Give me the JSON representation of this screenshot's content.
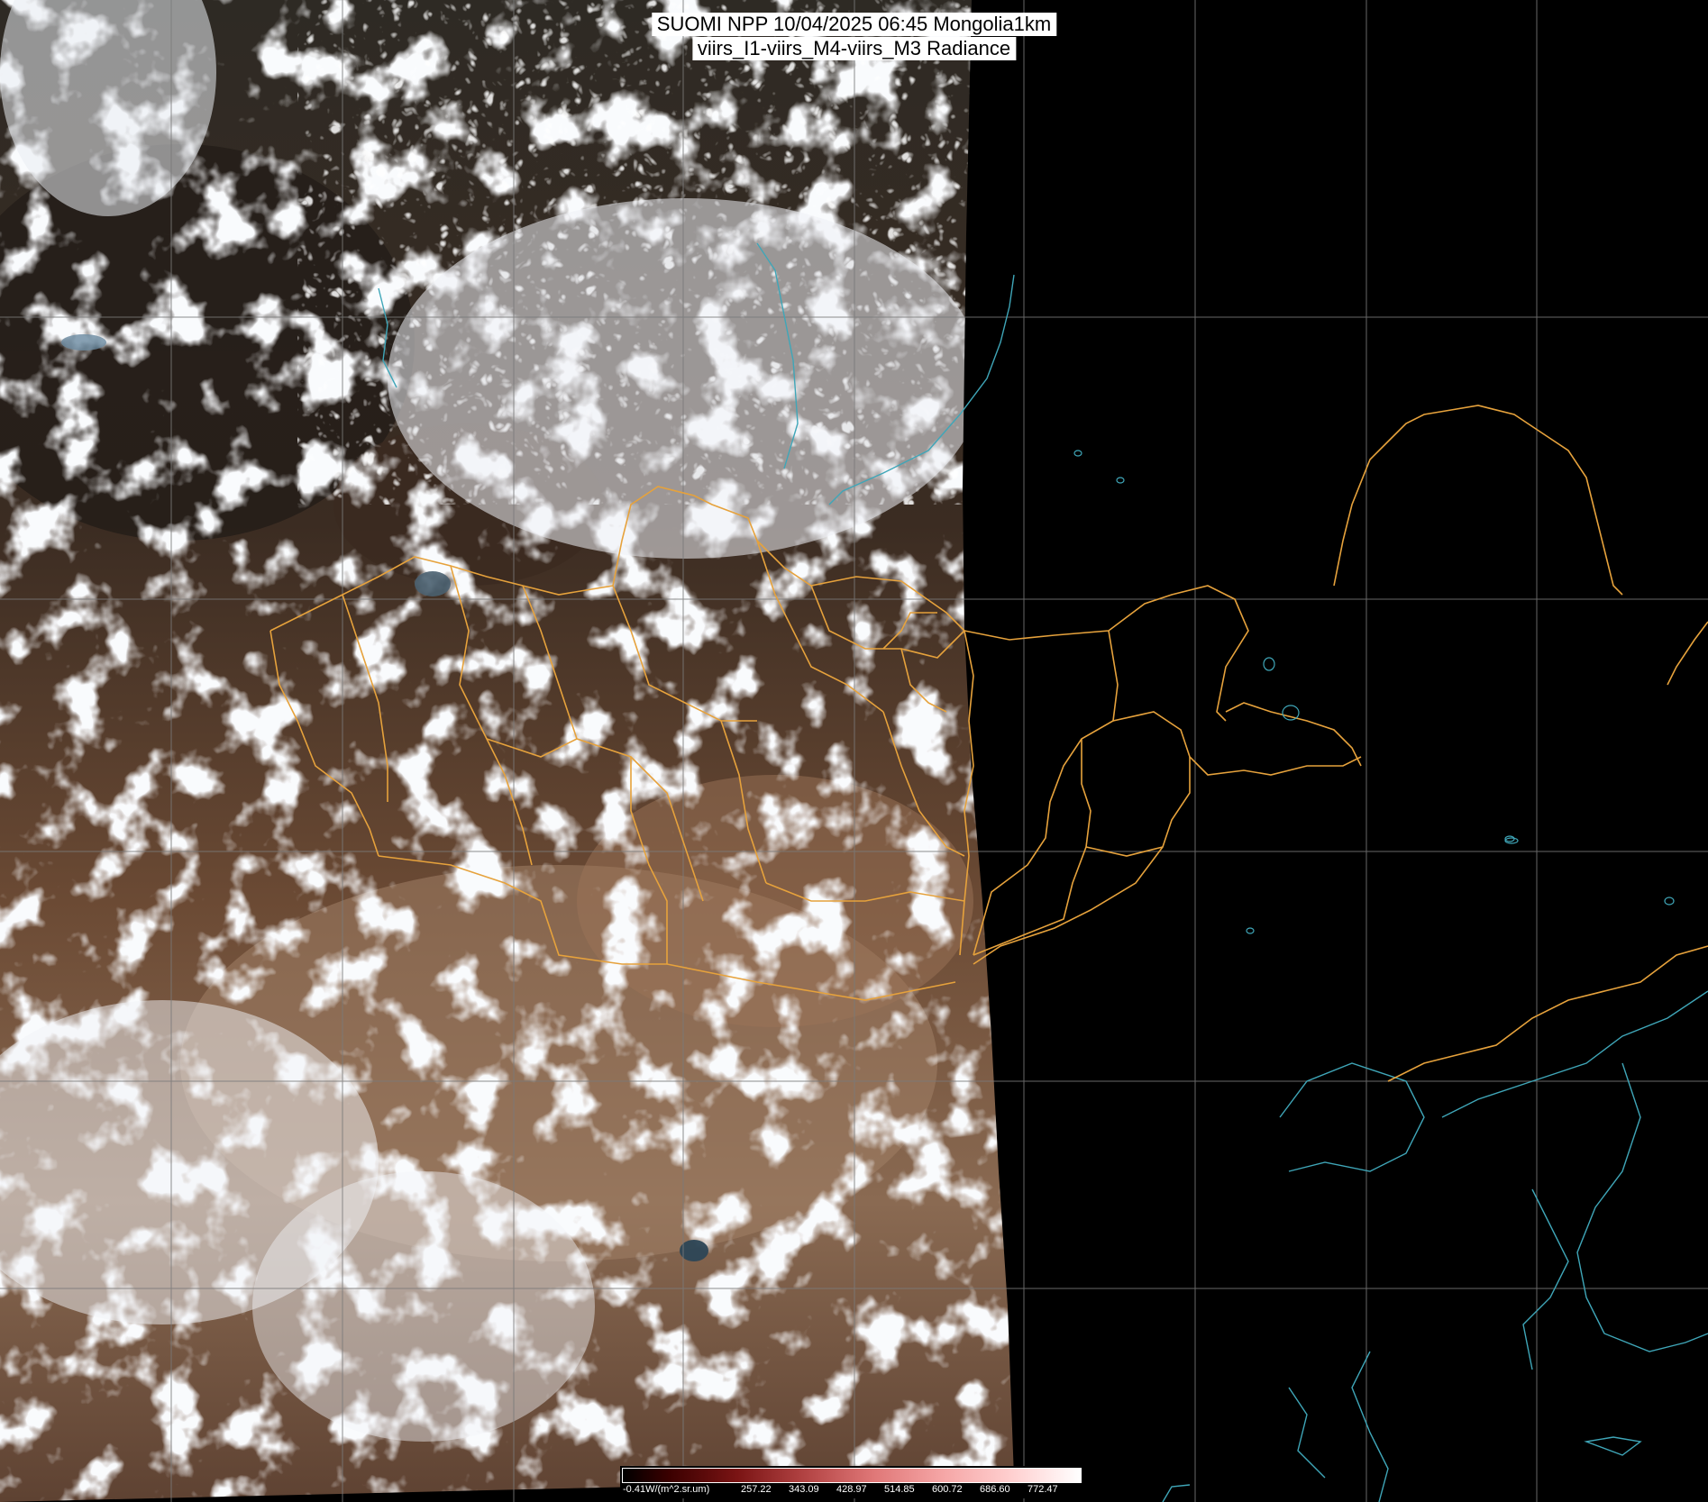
{
  "title": {
    "line1": "SUOMI NPP 10/04/2025 06:45 Mongolia1km",
    "line2": "viirs_I1-viirs_M4-viirs_M3 Radiance"
  },
  "legend": {
    "unit_label": "-0.41W/(m^2.sr.um)",
    "ticks": [
      "257.22",
      "343.09",
      "428.97",
      "514.85",
      "600.72",
      "686.60",
      "772.47"
    ]
  },
  "map": {
    "grid_color": "#7a7a7a",
    "border_color": "#e6a23c",
    "coastline_color": "#3fa6b8",
    "land_color": "#6b4a34",
    "cloud_color": "#f2f4f8",
    "no_data_color": "#000000"
  }
}
